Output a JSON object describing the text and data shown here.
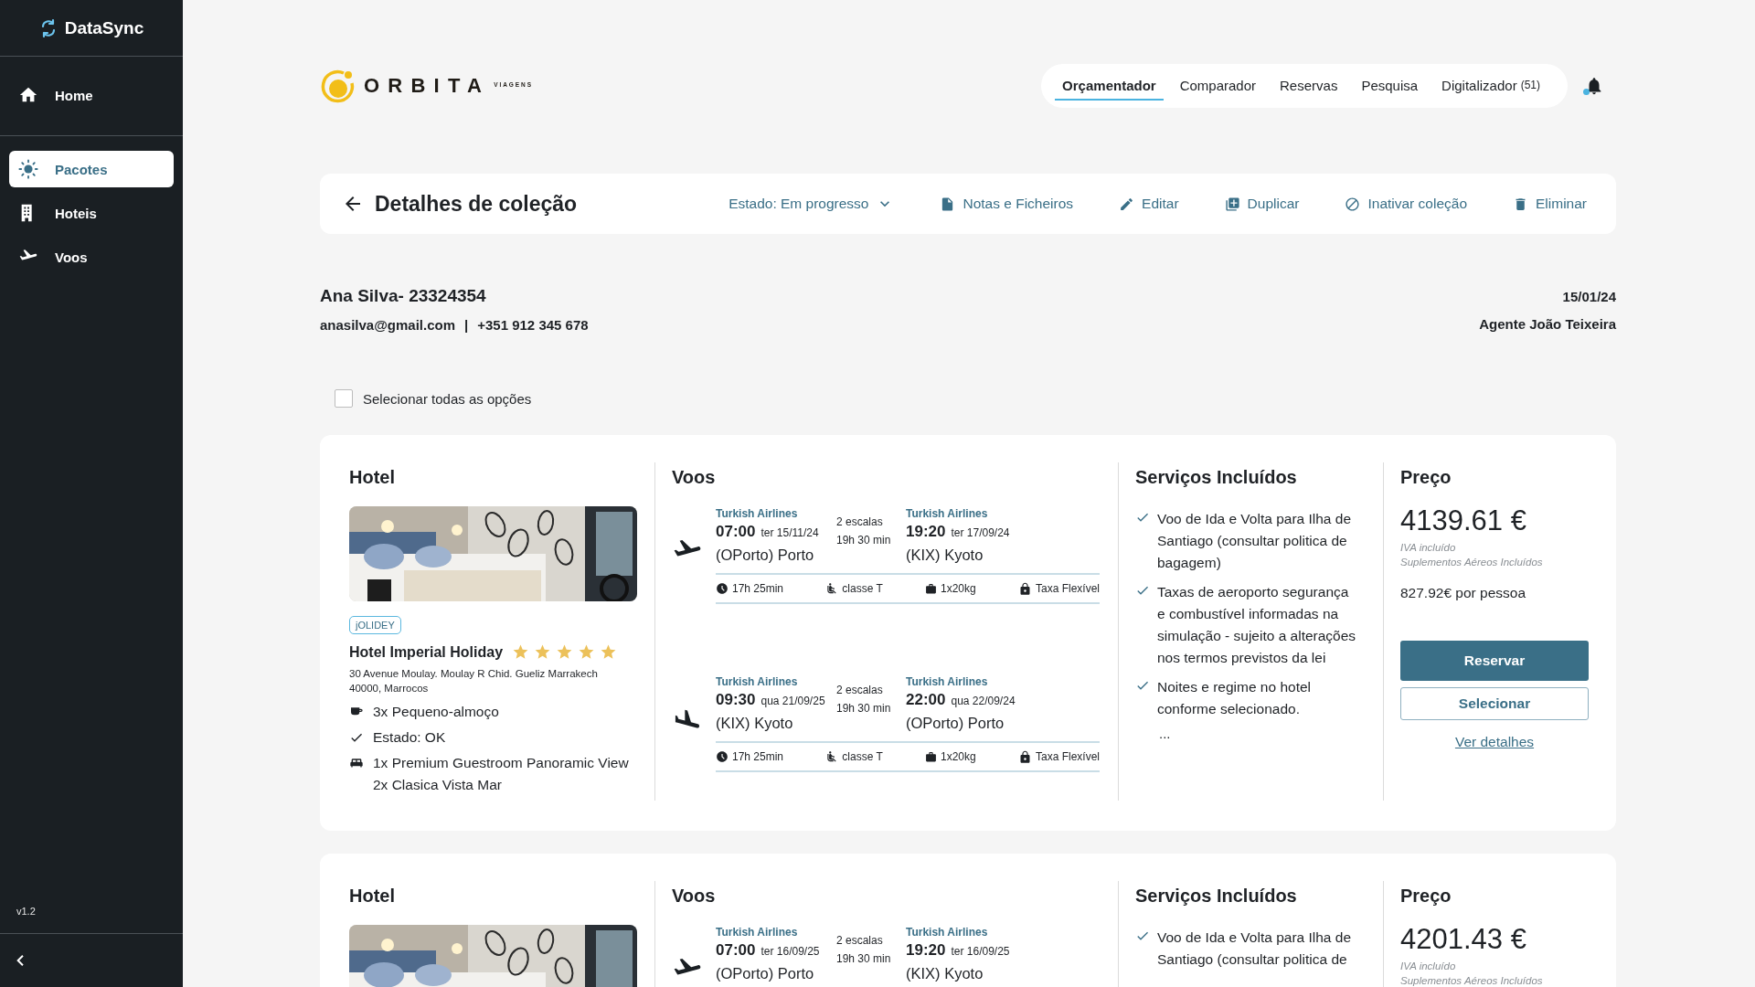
{
  "sidebar": {
    "brand": "DataSync",
    "sections": [
      {
        "items": [
          {
            "kind": "home",
            "label": "Home",
            "selected": false
          }
        ]
      },
      {
        "items": [
          {
            "kind": "packages",
            "label": "Pacotes",
            "selected": true
          },
          {
            "kind": "hotels",
            "label": "Hoteis",
            "selected": false
          },
          {
            "kind": "flights",
            "label": "Voos",
            "selected": false
          }
        ]
      }
    ],
    "version": "v1.2"
  },
  "header": {
    "logo": {
      "name": "ORBITA",
      "tagline": "VIAGENS"
    },
    "nav": [
      {
        "label": "Orçamentador",
        "selected": true
      },
      {
        "label": "Comparador",
        "selected": false
      },
      {
        "label": "Reservas",
        "selected": false
      },
      {
        "label": "Pesquisa",
        "selected": false
      },
      {
        "label": "Digitalizador",
        "count": "(51)",
        "selected": false
      }
    ],
    "notifications": {
      "unread": true
    }
  },
  "toolbar": {
    "title": "Detalhes de coleção",
    "status": "Estado: Em progresso",
    "actions": [
      {
        "kind": "notes",
        "label": "Notas e Ficheiros"
      },
      {
        "kind": "edit",
        "label": "Editar"
      },
      {
        "kind": "duplicate",
        "label": "Duplicar"
      },
      {
        "kind": "deactivate",
        "label": "Inativar coleção"
      },
      {
        "kind": "delete",
        "label": "Eliminar"
      }
    ]
  },
  "client": {
    "name": "Ana Silva- 23324354",
    "email": "anasilva@gmail.com",
    "separator": "|",
    "phone": "+351 912 345 678",
    "date": "15/01/24",
    "agent": "Agente João Teixeira"
  },
  "select_all": {
    "label": "Selecionar todas as opções",
    "checked": false
  },
  "packages": [
    {
      "hotel": {
        "heading": "Hotel",
        "badge": "jOLIDEY",
        "name": "Hotel Imperial Holiday",
        "stars": 5,
        "address": "30 Avenue Moulay. Moulay R Chid. Gueliz Marrakech 40000, Marrocos",
        "features": [
          {
            "kind": "breakfast",
            "lines": [
              "3x Pequeno-almoço"
            ]
          },
          {
            "kind": "status",
            "lines": [
              "Estado: OK"
            ]
          },
          {
            "kind": "room",
            "lines": [
              "1x Premium Guestroom Panoramic View",
              "2x Clasica Vista Mar"
            ]
          }
        ]
      },
      "flights": {
        "heading": "Voos",
        "segments": [
          {
            "kind": "outbound",
            "departure": {
              "airline": "Turkish Airlines",
              "time": "07:00",
              "date": "ter 15/11/24",
              "place": "(OPorto) Porto"
            },
            "stops": "2 escalas",
            "duration": "19h 30 min",
            "arrival": {
              "airline": "Turkish Airlines",
              "time": "19:20",
              "date": "ter 17/09/24",
              "place": "(KIX) Kyoto"
            },
            "details": {
              "time": "17h 25min",
              "cabin": "classe T",
              "baggage": "1x20kg",
              "fare": "Taxa Flexível"
            }
          },
          {
            "kind": "return",
            "departure": {
              "airline": "Turkish Airlines",
              "time": "09:30",
              "date": "qua 21/09/25",
              "place": "(KIX) Kyoto"
            },
            "stops": "2 escalas",
            "duration": "19h 30 min",
            "arrival": {
              "airline": "Turkish Airlines",
              "time": "22:00",
              "date": "qua 22/09/24",
              "place": "(OPorto) Porto"
            },
            "details": {
              "time": "17h 25min",
              "cabin": "classe T",
              "baggage": "1x20kg",
              "fare": "Taxa Flexível"
            }
          }
        ]
      },
      "services": {
        "heading": "Serviços Incluídos",
        "items": [
          "Voo de Ida e Volta para Ilha de Santiago (consultar politica de bagagem)",
          "Taxas de aeroporto segurança e combustível informadas na simulação - sujeito a alterações nos termos previstos da lei",
          "Noites e regime no hotel conforme selecionado."
        ],
        "more": "..."
      },
      "price": {
        "heading": "Preço",
        "amount": "4139.61 €",
        "notes": [
          "IVA incluído",
          "Suplementos Aéreos Incluídos"
        ],
        "per_person": "827.92€ por pessoa",
        "primary": "Reservar",
        "secondary": "Selecionar",
        "link": "Ver detalhes"
      }
    },
    {
      "hotel": {
        "heading": "Hotel"
      },
      "flights": {
        "heading": "Voos",
        "segments": [
          {
            "kind": "outbound",
            "departure": {
              "airline": "Turkish Airlines",
              "time": "07:00",
              "date": "ter 16/09/25",
              "place": "(OPorto) Porto"
            },
            "stops": "2 escalas",
            "duration": "19h 30 min",
            "arrival": {
              "airline": "Turkish Airlines",
              "time": "19:20",
              "date": "ter 16/09/25",
              "place": "(KIX) Kyoto"
            }
          }
        ]
      },
      "services": {
        "heading": "Serviços Incluídos",
        "items": [
          "Voo de Ida e Volta para Ilha de Santiago (consultar politica de"
        ]
      },
      "price": {
        "heading": "Preço",
        "amount": "4201.43 €",
        "notes": [
          "IVA incluído",
          "Suplementos Aéreos Incluídos"
        ]
      }
    }
  ]
}
